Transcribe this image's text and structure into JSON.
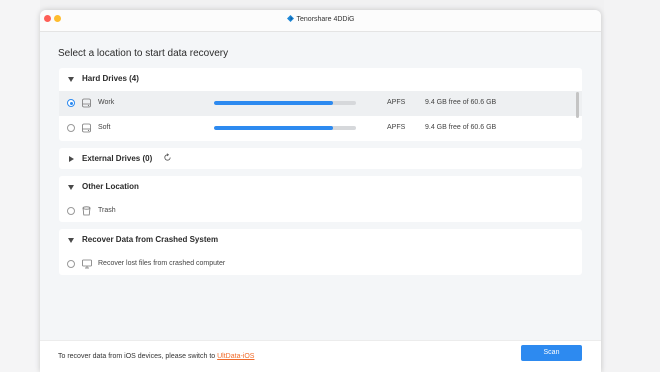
{
  "window": {
    "title": "Tenorshare 4DDiG"
  },
  "heading": "Select a location to start data recovery",
  "sections": {
    "hard_drives": {
      "title": "Hard Drives (4)",
      "items": [
        {
          "label": "Work",
          "usage_fraction": 0.84,
          "filesystem": "APFS",
          "free": "9.4 GB free of 60.6 GB",
          "selected": true
        },
        {
          "label": "Soft",
          "usage_fraction": 0.84,
          "filesystem": "APFS",
          "free": "9.4 GB free of 60.6 GB",
          "selected": false
        }
      ]
    },
    "external_drives": {
      "title": "External Drives (0)"
    },
    "other_location": {
      "title": "Other Location",
      "items": [
        {
          "label": "Trash"
        }
      ]
    },
    "crashed_system": {
      "title": "Recover Data from Crashed System",
      "items": [
        {
          "label": "Recover lost files from crashed computer"
        }
      ]
    }
  },
  "footer": {
    "text": "To recover data from iOS devices, please switch to ",
    "link": "UltData-iOS",
    "scan_label": "Scan"
  },
  "colors": {
    "accent": "#2d8af0",
    "link": "#f06b2a"
  }
}
